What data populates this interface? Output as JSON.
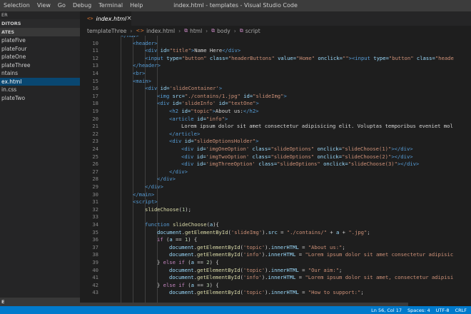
{
  "menu": [
    "Selection",
    "View",
    "Go",
    "Debug",
    "Terminal",
    "Help"
  ],
  "window_title": "index.html - templates - Visual Studio Code",
  "sidebar": {
    "header": "ER",
    "open_editors": "DITORS",
    "section": "ATES",
    "items": [
      {
        "label": "plateFive",
        "active": false
      },
      {
        "label": "plateFour",
        "active": false
      },
      {
        "label": "plateOne",
        "active": false
      },
      {
        "label": "plateThree",
        "active": false
      },
      {
        "label": "ntains",
        "active": false
      },
      {
        "label": "ex.html",
        "active": true
      },
      {
        "label": "in.css",
        "active": false
      },
      {
        "label": "plateTwo",
        "active": false
      }
    ],
    "bottom": "E"
  },
  "tab": {
    "icon": "<>",
    "label": "index.html",
    "close": "×"
  },
  "breadcrumb": {
    "folder": "templateThree",
    "file_icon": "<>",
    "file": "index.html",
    "html": "html",
    "body": "body",
    "script": "script"
  },
  "code_lines": [
    {
      "n": "",
      "indent": 1,
      "parts": [
        [
          "tag",
          "</nav>"
        ]
      ]
    },
    {
      "n": "10",
      "indent": 2,
      "parts": [
        [
          "tag",
          "<header>"
        ]
      ]
    },
    {
      "n": "11",
      "indent": 3,
      "parts": [
        [
          "tag",
          "<div "
        ],
        [
          "attr",
          "id="
        ],
        [
          "str",
          "\"title\""
        ],
        [
          "tag",
          ">"
        ],
        [
          "txt",
          "Name Here"
        ],
        [
          "tag",
          "</div>"
        ]
      ]
    },
    {
      "n": "12",
      "indent": 3,
      "parts": [
        [
          "tag",
          "<input "
        ],
        [
          "attr",
          "type="
        ],
        [
          "str",
          "\"button\" "
        ],
        [
          "attr",
          "class="
        ],
        [
          "str",
          "\"headerButtons\" "
        ],
        [
          "attr",
          "value="
        ],
        [
          "str",
          "\"Home\" "
        ],
        [
          "attr",
          "onclick="
        ],
        [
          "str",
          "\"\""
        ],
        [
          "tag",
          "><input "
        ],
        [
          "attr",
          "type="
        ],
        [
          "str",
          "\"button\" "
        ],
        [
          "attr",
          "class="
        ],
        [
          "str",
          "\"heade"
        ]
      ]
    },
    {
      "n": "13",
      "indent": 2,
      "parts": [
        [
          "tag",
          "</header>"
        ]
      ]
    },
    {
      "n": "14",
      "indent": 2,
      "parts": [
        [
          "tag",
          "<br>"
        ]
      ]
    },
    {
      "n": "15",
      "indent": 2,
      "parts": [
        [
          "tag",
          "<main>"
        ]
      ]
    },
    {
      "n": "16",
      "indent": 3,
      "parts": [
        [
          "tag",
          "<div "
        ],
        [
          "attr",
          "id="
        ],
        [
          "str",
          "'slideContainer'"
        ],
        [
          "tag",
          ">"
        ]
      ]
    },
    {
      "n": "17",
      "indent": 4,
      "parts": [
        [
          "tag",
          "<img "
        ],
        [
          "attr",
          "src="
        ],
        [
          "str",
          "\"./contains/1.jpg\" "
        ],
        [
          "attr",
          "id="
        ],
        [
          "str",
          "\"slideImg\""
        ],
        [
          "tag",
          ">"
        ]
      ]
    },
    {
      "n": "18",
      "indent": 4,
      "parts": [
        [
          "tag",
          "<div "
        ],
        [
          "attr",
          "id="
        ],
        [
          "str",
          "'slideInfo' "
        ],
        [
          "attr",
          "id="
        ],
        [
          "str",
          "\"textOne\""
        ],
        [
          "tag",
          ">"
        ]
      ]
    },
    {
      "n": "19",
      "indent": 5,
      "parts": [
        [
          "tag",
          "<h2 "
        ],
        [
          "attr",
          "id="
        ],
        [
          "str",
          "\"topic\""
        ],
        [
          "tag",
          ">"
        ],
        [
          "txt",
          "About us:"
        ],
        [
          "tag",
          "</h2>"
        ]
      ]
    },
    {
      "n": "20",
      "indent": 5,
      "parts": [
        [
          "tag",
          "<article "
        ],
        [
          "attr",
          "id="
        ],
        [
          "str",
          "\"info\""
        ],
        [
          "tag",
          ">"
        ]
      ]
    },
    {
      "n": "21",
      "indent": 6,
      "parts": [
        [
          "txt",
          "Lorem ipsum dolor sit amet consectetur adipisicing elit. Voluptas temporibus eveniet mol"
        ]
      ]
    },
    {
      "n": "22",
      "indent": 5,
      "parts": [
        [
          "tag",
          "</article>"
        ]
      ]
    },
    {
      "n": "23",
      "indent": 5,
      "parts": [
        [
          "tag",
          "<div "
        ],
        [
          "attr",
          "id="
        ],
        [
          "str",
          "\"slideOptionsHolder\""
        ],
        [
          "tag",
          ">"
        ]
      ]
    },
    {
      "n": "24",
      "indent": 6,
      "parts": [
        [
          "tag",
          "<div "
        ],
        [
          "attr",
          "id="
        ],
        [
          "str",
          "'imgOneOption' "
        ],
        [
          "attr",
          "class="
        ],
        [
          "str",
          "\"slideOptions\" "
        ],
        [
          "attr",
          "onclick="
        ],
        [
          "str",
          "\"slideChoose(1)\""
        ],
        [
          "tag",
          "></div>"
        ]
      ]
    },
    {
      "n": "25",
      "indent": 6,
      "parts": [
        [
          "tag",
          "<div "
        ],
        [
          "attr",
          "id="
        ],
        [
          "str",
          "'imgTwoOption' "
        ],
        [
          "attr",
          "class="
        ],
        [
          "str",
          "\"slideOptions\" "
        ],
        [
          "attr",
          "onclick="
        ],
        [
          "str",
          "\"slideChoose(2)\""
        ],
        [
          "tag",
          "></div>"
        ]
      ]
    },
    {
      "n": "26",
      "indent": 6,
      "parts": [
        [
          "tag",
          "<div "
        ],
        [
          "attr",
          "id="
        ],
        [
          "str",
          "'imgThreeOption' "
        ],
        [
          "attr",
          "class="
        ],
        [
          "str",
          "\"slideOptions\" "
        ],
        [
          "attr",
          "onclick="
        ],
        [
          "str",
          "\"slideChoose(3)\""
        ],
        [
          "tag",
          "></div>"
        ]
      ]
    },
    {
      "n": "27",
      "indent": 5,
      "parts": [
        [
          "tag",
          "</div>"
        ]
      ]
    },
    {
      "n": "28",
      "indent": 4,
      "parts": [
        [
          "tag",
          "</div>"
        ]
      ]
    },
    {
      "n": "29",
      "indent": 3,
      "parts": [
        [
          "tag",
          "</div>"
        ]
      ]
    },
    {
      "n": "30",
      "indent": 2,
      "parts": [
        [
          "tag",
          "</main>"
        ]
      ]
    },
    {
      "n": "31",
      "indent": 2,
      "parts": [
        [
          "tag",
          "<script>"
        ]
      ]
    },
    {
      "n": "32",
      "indent": 3,
      "parts": [
        [
          "fn",
          "slideChoose"
        ],
        [
          "txt",
          "("
        ],
        [
          "num",
          "1"
        ],
        [
          "txt",
          ");"
        ]
      ]
    },
    {
      "n": "33",
      "indent": 0,
      "parts": []
    },
    {
      "n": "34",
      "indent": 3,
      "parts": [
        [
          "tag",
          "function "
        ],
        [
          "fn",
          "slideChoose"
        ],
        [
          "txt",
          "("
        ],
        [
          "var",
          "a"
        ],
        [
          "txt",
          "){"
        ]
      ]
    },
    {
      "n": "35",
      "indent": 4,
      "parts": [
        [
          "var",
          "document"
        ],
        [
          "txt",
          "."
        ],
        [
          "fn",
          "getElementById"
        ],
        [
          "txt",
          "("
        ],
        [
          "str",
          "'slideImg'"
        ],
        [
          "txt",
          ")."
        ],
        [
          "var",
          "src"
        ],
        [
          "txt",
          " = "
        ],
        [
          "str",
          "\"./contains/\""
        ],
        [
          "txt",
          " + "
        ],
        [
          "var",
          "a"
        ],
        [
          "txt",
          " + "
        ],
        [
          "str",
          "\".jpg\""
        ],
        [
          "txt",
          ";"
        ]
      ]
    },
    {
      "n": "36",
      "indent": 4,
      "parts": [
        [
          "kw",
          "if"
        ],
        [
          "txt",
          " ("
        ],
        [
          "var",
          "a"
        ],
        [
          "txt",
          " == "
        ],
        [
          "num",
          "1"
        ],
        [
          "txt",
          ") {"
        ]
      ]
    },
    {
      "n": "37",
      "indent": 5,
      "parts": [
        [
          "var",
          "document"
        ],
        [
          "txt",
          "."
        ],
        [
          "fn",
          "getElementById"
        ],
        [
          "txt",
          "("
        ],
        [
          "str",
          "'topic'"
        ],
        [
          "txt",
          ")."
        ],
        [
          "var",
          "innerHTML"
        ],
        [
          "txt",
          " = "
        ],
        [
          "str",
          "\"About us:\""
        ],
        [
          "txt",
          ";"
        ]
      ]
    },
    {
      "n": "38",
      "indent": 5,
      "parts": [
        [
          "var",
          "document"
        ],
        [
          "txt",
          "."
        ],
        [
          "fn",
          "getElementById"
        ],
        [
          "txt",
          "("
        ],
        [
          "str",
          "'info'"
        ],
        [
          "txt",
          ")."
        ],
        [
          "var",
          "innerHTML"
        ],
        [
          "txt",
          " = "
        ],
        [
          "str",
          "\"Lorem ipsum dolor sit amet consectetur adipisic"
        ]
      ]
    },
    {
      "n": "39",
      "indent": 4,
      "parts": [
        [
          "txt",
          "} "
        ],
        [
          "kw",
          "else if"
        ],
        [
          "txt",
          " ("
        ],
        [
          "var",
          "a"
        ],
        [
          "txt",
          " == "
        ],
        [
          "num",
          "2"
        ],
        [
          "txt",
          ") {"
        ]
      ]
    },
    {
      "n": "40",
      "indent": 5,
      "parts": [
        [
          "var",
          "document"
        ],
        [
          "txt",
          "."
        ],
        [
          "fn",
          "getElementById"
        ],
        [
          "txt",
          "("
        ],
        [
          "str",
          "'topic'"
        ],
        [
          "txt",
          ")."
        ],
        [
          "var",
          "innerHTML"
        ],
        [
          "txt",
          " = "
        ],
        [
          "str",
          "\"Our aim:\""
        ],
        [
          "txt",
          ";"
        ]
      ]
    },
    {
      "n": "41",
      "indent": 5,
      "parts": [
        [
          "var",
          "document"
        ],
        [
          "txt",
          "."
        ],
        [
          "fn",
          "getElementById"
        ],
        [
          "txt",
          "("
        ],
        [
          "str",
          "'info'"
        ],
        [
          "txt",
          ")."
        ],
        [
          "var",
          "innerHTML"
        ],
        [
          "txt",
          " = "
        ],
        [
          "str",
          "\"Lorem ipsum dolor sit amet, consectetur adipisi"
        ]
      ]
    },
    {
      "n": "42",
      "indent": 4,
      "parts": [
        [
          "txt",
          "} "
        ],
        [
          "kw",
          "else if"
        ],
        [
          "txt",
          " ("
        ],
        [
          "var",
          "a"
        ],
        [
          "txt",
          " == "
        ],
        [
          "num",
          "3"
        ],
        [
          "txt",
          ") {"
        ]
      ]
    },
    {
      "n": "43",
      "indent": 5,
      "parts": [
        [
          "var",
          "document"
        ],
        [
          "txt",
          "."
        ],
        [
          "fn",
          "getElementById"
        ],
        [
          "txt",
          "("
        ],
        [
          "str",
          "'topic'"
        ],
        [
          "txt",
          ")."
        ],
        [
          "var",
          "innerHTML"
        ],
        [
          "txt",
          " = "
        ],
        [
          "str",
          "\"How to support:\""
        ],
        [
          "txt",
          ";"
        ]
      ]
    }
  ],
  "status": {
    "position": "Ln 56, Col 17",
    "spaces": "Spaces: 4",
    "encoding": "UTF-8",
    "eol": "CRLF"
  },
  "colors": {
    "accent": "#007acc",
    "tag": "#569cd6",
    "attribute": "#9cdcfe",
    "string": "#ce9178",
    "function": "#dcdcaa",
    "keyword": "#c586c0"
  }
}
